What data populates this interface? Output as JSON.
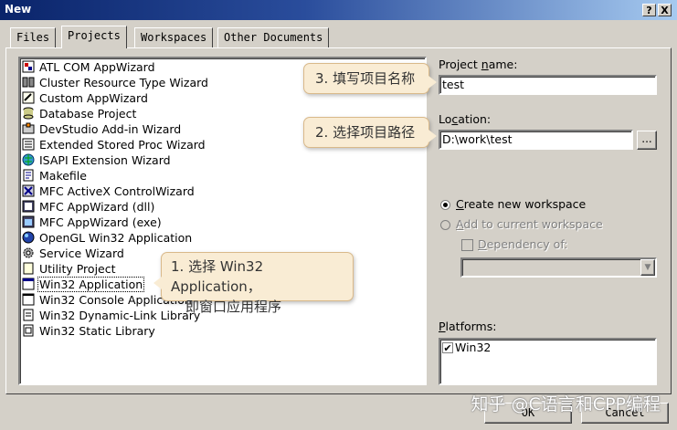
{
  "window": {
    "title": "New",
    "help_label": "?",
    "close_label": "X"
  },
  "tabs": [
    {
      "label": "Files"
    },
    {
      "label": "Projects"
    },
    {
      "label": "Workspaces"
    },
    {
      "label": "Other Documents"
    }
  ],
  "project_types": [
    {
      "label": "ATL COM AppWizard"
    },
    {
      "label": "Cluster Resource Type Wizard"
    },
    {
      "label": "Custom AppWizard"
    },
    {
      "label": "Database Project"
    },
    {
      "label": "DevStudio Add-in Wizard"
    },
    {
      "label": "Extended Stored Proc Wizard"
    },
    {
      "label": "ISAPI Extension Wizard"
    },
    {
      "label": "Makefile"
    },
    {
      "label": "MFC ActiveX ControlWizard"
    },
    {
      "label": "MFC AppWizard (dll)"
    },
    {
      "label": "MFC AppWizard (exe)"
    },
    {
      "label": "OpenGL Win32 Application"
    },
    {
      "label": "Service Wizard"
    },
    {
      "label": "Utility Project"
    },
    {
      "label": "Win32 Application"
    },
    {
      "label": "Win32 Console Application"
    },
    {
      "label": "Win32 Dynamic-Link Library"
    },
    {
      "label": "Win32 Static Library"
    }
  ],
  "project_name": {
    "label_pre": "Project ",
    "label_key": "n",
    "label_post": "ame:",
    "value": "test"
  },
  "location": {
    "label_pre": "Lo",
    "label_key": "c",
    "label_post": "ation:",
    "value": "D:\\work\\test",
    "browse_label": "..."
  },
  "workspace": {
    "create_pre": "",
    "create_key": "C",
    "create_post": "reate new workspace",
    "add_pre": "",
    "add_key": "A",
    "add_post": "dd to current workspace",
    "dependency_pre": "",
    "dependency_key": "D",
    "dependency_post": "ependency of:"
  },
  "platforms": {
    "label_pre": "",
    "label_key": "P",
    "label_post": "latforms:",
    "items": [
      {
        "label": "Win32",
        "checked": true
      }
    ]
  },
  "buttons": {
    "ok": "OK",
    "cancel": "Cancel"
  },
  "callouts": {
    "step3": "3. 填写项目名称",
    "step2": "2. 选择项目路径",
    "step1_line1": "1. 选择 Win32 Application，",
    "step1_line2": "即窗口应用程序"
  },
  "watermark": "知乎 @C语言和CPP编程",
  "colors": {
    "selection": "#0a246a",
    "callout_bg": "#f9ecd4",
    "titlebar": "#0a246a"
  }
}
